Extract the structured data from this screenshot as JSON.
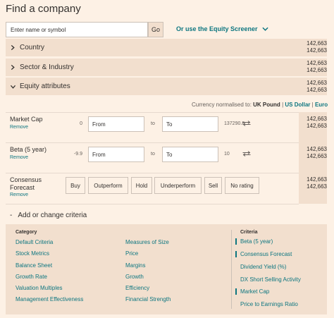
{
  "page": {
    "title": "Find a company"
  },
  "search": {
    "placeholder": "Enter name or symbol",
    "go_label": "Go"
  },
  "screener": {
    "label": "Or use the Equity Screener"
  },
  "sections": [
    {
      "label": "Country",
      "counts": [
        "142,663",
        "142,663"
      ]
    },
    {
      "label": "Sector & Industry",
      "counts": [
        "142,663",
        "142,663"
      ]
    },
    {
      "label": "Equity attributes",
      "counts": [
        "142,663",
        "142,663"
      ]
    }
  ],
  "currency": {
    "prefix": "Currency normalised to:",
    "options": [
      "UK Pound",
      "US Dollar",
      "Euro"
    ],
    "separator": "|"
  },
  "attributes": [
    {
      "label": "Market Cap",
      "remove": "Remove",
      "min": "0",
      "from_placeholder": "From",
      "to_text": "to",
      "to_placeholder": "To",
      "max": "137290.8…",
      "counts": [
        "142,663",
        "142,663"
      ]
    },
    {
      "label": "Beta (5 year)",
      "remove": "Remove",
      "min": "-9.9",
      "from_placeholder": "From",
      "to_text": "to",
      "to_placeholder": "To",
      "max": "10",
      "counts": [
        "142,663",
        "142,663"
      ]
    },
    {
      "label_line1": "Consensus",
      "label_line2": "Forecast",
      "remove": "Remove",
      "buttons": [
        "Buy",
        "Outperform",
        "Hold",
        "Underperform",
        "Sell",
        "No rating"
      ],
      "counts": [
        "142,663",
        "142,663"
      ]
    }
  ],
  "add_criteria": {
    "toggle": "-",
    "label": "Add or change criteria"
  },
  "category": {
    "heading": "Category",
    "col1": [
      "Default Criteria",
      "Stock Metrics",
      "Balance Sheet",
      "Growth Rate",
      "Valuation Multiples",
      "Management Effectiveness"
    ],
    "col2": [
      "Measures of Size",
      "Price",
      "Margins",
      "Growth",
      "Efficiency",
      "Financial Strength"
    ]
  },
  "criteria": {
    "heading": "Criteria",
    "items": [
      {
        "label": "Beta (5 year)",
        "active": true
      },
      {
        "label": "Consensus Forecast",
        "active": true
      },
      {
        "label": "Dividend Yield (%)",
        "active": false
      },
      {
        "label": "DX Short Selling Activity",
        "active": false
      },
      {
        "label": "Market Cap",
        "active": true
      },
      {
        "label": "Price to Earnings Ratio",
        "active": false
      }
    ]
  },
  "colors": {
    "background": "#fdf1e5",
    "panel": "#f2dfce",
    "link": "#0d7680"
  },
  "icons": [
    "chevron-right-icon",
    "chevron-down-icon",
    "swap-arrows-icon"
  ]
}
